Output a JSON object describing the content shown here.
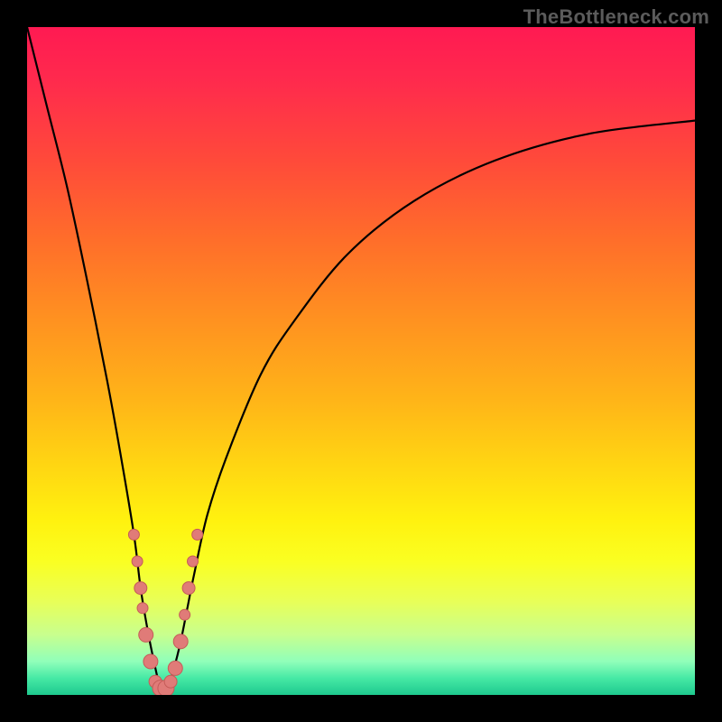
{
  "watermark": {
    "text": "TheBottleneck.com"
  },
  "colors": {
    "frame": "#000000",
    "curve": "#000000",
    "dot_fill": "#e07b78",
    "dot_stroke": "#c55b58",
    "gradient_stops": [
      "#ff1a52",
      "#ff2a4d",
      "#ff4a3a",
      "#ff6e2a",
      "#ff9220",
      "#ffb518",
      "#ffd712",
      "#fff20f",
      "#faff22",
      "#e8ff58",
      "#c8ff8e",
      "#90ffba",
      "#46e9a5",
      "#1ec98e"
    ]
  },
  "chart_data": {
    "type": "line",
    "title": "",
    "xlabel": "",
    "ylabel": "",
    "x_range": [
      0,
      100
    ],
    "y_range": [
      0,
      100
    ],
    "note": "x is horizontal position (0=left,100=right); y is bottleneck % (0=green bottom,100=red top). V-shaped curve with minimum near x≈20.",
    "series": [
      {
        "name": "bottleneck-curve",
        "x": [
          0,
          3,
          6,
          9,
          12,
          14,
          16,
          17,
          18,
          19,
          20,
          21,
          22,
          23,
          24,
          25,
          27,
          30,
          35,
          40,
          48,
          58,
          70,
          84,
          100
        ],
        "y": [
          100,
          88,
          76,
          62,
          47,
          36,
          24,
          16,
          10,
          5,
          1,
          1,
          4,
          8,
          13,
          18,
          27,
          36,
          48,
          56,
          66,
          74,
          80,
          84,
          86
        ]
      }
    ],
    "dots": {
      "name": "highlight-dots",
      "x": [
        16.0,
        16.5,
        17.0,
        17.3,
        17.8,
        18.5,
        19.2,
        20.0,
        20.8,
        21.5,
        22.2,
        23.0,
        23.6,
        24.2,
        24.8,
        25.5
      ],
      "y": [
        24,
        20,
        16,
        13,
        9,
        5,
        2,
        1,
        1,
        2,
        4,
        8,
        12,
        16,
        20,
        24
      ],
      "r": [
        6,
        6,
        7,
        6,
        8,
        8,
        7,
        9,
        9,
        7,
        8,
        8,
        6,
        7,
        6,
        6
      ]
    }
  }
}
